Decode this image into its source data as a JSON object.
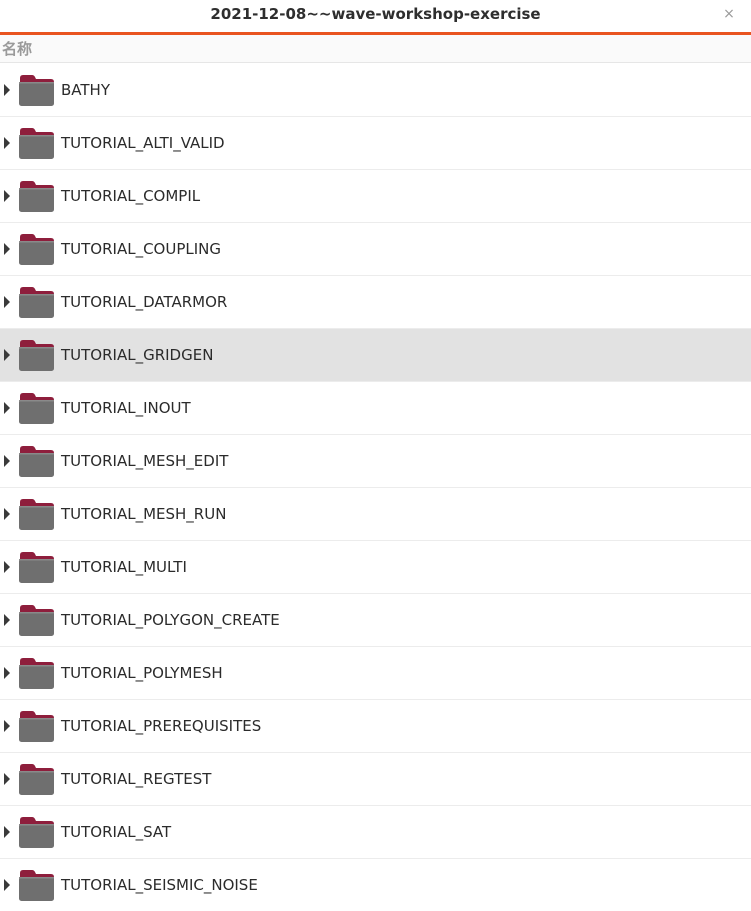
{
  "window": {
    "title": "2021-12-08~~wave-workshop-exercise",
    "close_glyph": "×",
    "accent_color": "#e95420"
  },
  "header": {
    "name_column": "名称"
  },
  "selected_index": 5,
  "folders": [
    {
      "name": "BATHY"
    },
    {
      "name": "TUTORIAL_ALTI_VALID"
    },
    {
      "name": "TUTORIAL_COMPIL"
    },
    {
      "name": "TUTORIAL_COUPLING"
    },
    {
      "name": "TUTORIAL_DATARMOR"
    },
    {
      "name": "TUTORIAL_GRIDGEN"
    },
    {
      "name": "TUTORIAL_INOUT"
    },
    {
      "name": "TUTORIAL_MESH_EDIT"
    },
    {
      "name": "TUTORIAL_MESH_RUN"
    },
    {
      "name": "TUTORIAL_MULTI"
    },
    {
      "name": "TUTORIAL_POLYGON_CREATE"
    },
    {
      "name": "TUTORIAL_POLYMESH"
    },
    {
      "name": "TUTORIAL_PREREQUISITES"
    },
    {
      "name": "TUTORIAL_REGTEST"
    },
    {
      "name": "TUTORIAL_SAT"
    },
    {
      "name": "TUTORIAL_SEISMIC_NOISE"
    }
  ],
  "icons": {
    "expander": "triangle-right-icon",
    "folder": "folder-icon"
  },
  "colors": {
    "folder_body": "#6f6f6f",
    "folder_tab": "#8e1e3c",
    "selected_row": "#e2e2e2"
  }
}
